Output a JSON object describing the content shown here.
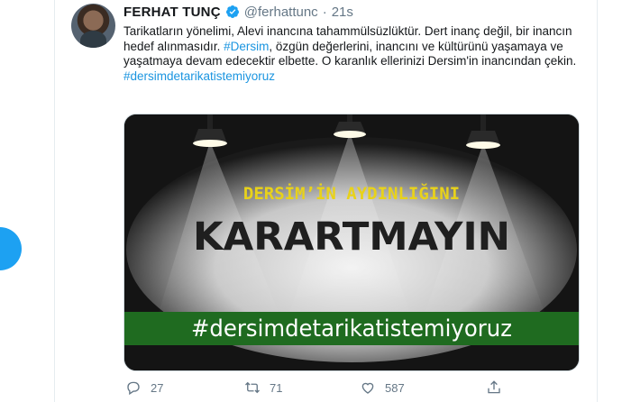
{
  "tweet": {
    "author_name": "FERHAT TUNÇ",
    "handle": "@ferhattunc",
    "separator": "·",
    "time": "21s",
    "text_part1": "Tarikatların yönelimi, Alevi inancına tahammülsüzlüktür. Dert inanç değil, bir inancın hedef alınmasıdır. ",
    "text_link": "#Dersim",
    "text_part2": ", özgün değerlerini, inancını ve kültürünü yaşamaya ve yaşatmaya devam edecektir elbette. O karanlık ellerinizi Dersim'in inancından çekin.",
    "hashtag_line": "#dersimdetarikatistemiyoruz"
  },
  "media": {
    "line1": "DERSİM’İN AYDINLIĞINI",
    "line2": "KARARTMAYIN",
    "banner": "#dersimdetarikatistemiyoruz",
    "colors": {
      "line1": "#e8d21a",
      "line2": "#1f1f1f",
      "banner_bg": "#1f6b20",
      "banner_text": "#ffffff"
    }
  },
  "actions": {
    "reply_count": "27",
    "retweet_count": "71",
    "like_count": "587"
  },
  "icons": [
    "verified-badge-icon",
    "reply-icon",
    "retweet-icon",
    "like-icon",
    "share-icon"
  ],
  "colors": {
    "accent": "#1da1f2",
    "link": "#1b95e0",
    "muted": "#657786"
  }
}
